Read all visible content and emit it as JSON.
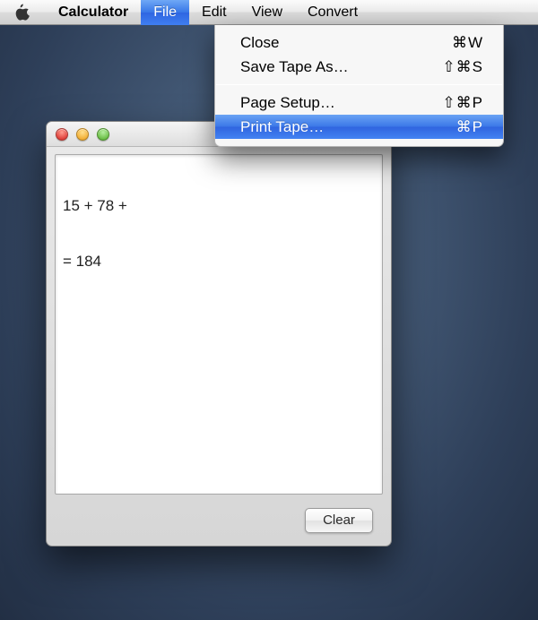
{
  "menubar": {
    "app_name": "Calculator",
    "items": [
      {
        "label": "File",
        "open": true
      },
      {
        "label": "Edit",
        "open": false
      },
      {
        "label": "View",
        "open": false
      },
      {
        "label": "Convert",
        "open": false
      }
    ]
  },
  "file_menu": {
    "items": [
      {
        "label": "Close",
        "shortcut": "⌘W",
        "highlighted": false
      },
      {
        "label": "Save Tape As…",
        "shortcut": "⇧⌘S",
        "highlighted": false
      },
      {
        "separator": true
      },
      {
        "label": "Page Setup…",
        "shortcut": "⇧⌘P",
        "highlighted": false
      },
      {
        "label": "Print Tape…",
        "shortcut": "⌘P",
        "highlighted": true
      }
    ]
  },
  "tape_window": {
    "lines": [
      "15 + 78 +",
      "= 184"
    ],
    "clear_button": "Clear"
  }
}
